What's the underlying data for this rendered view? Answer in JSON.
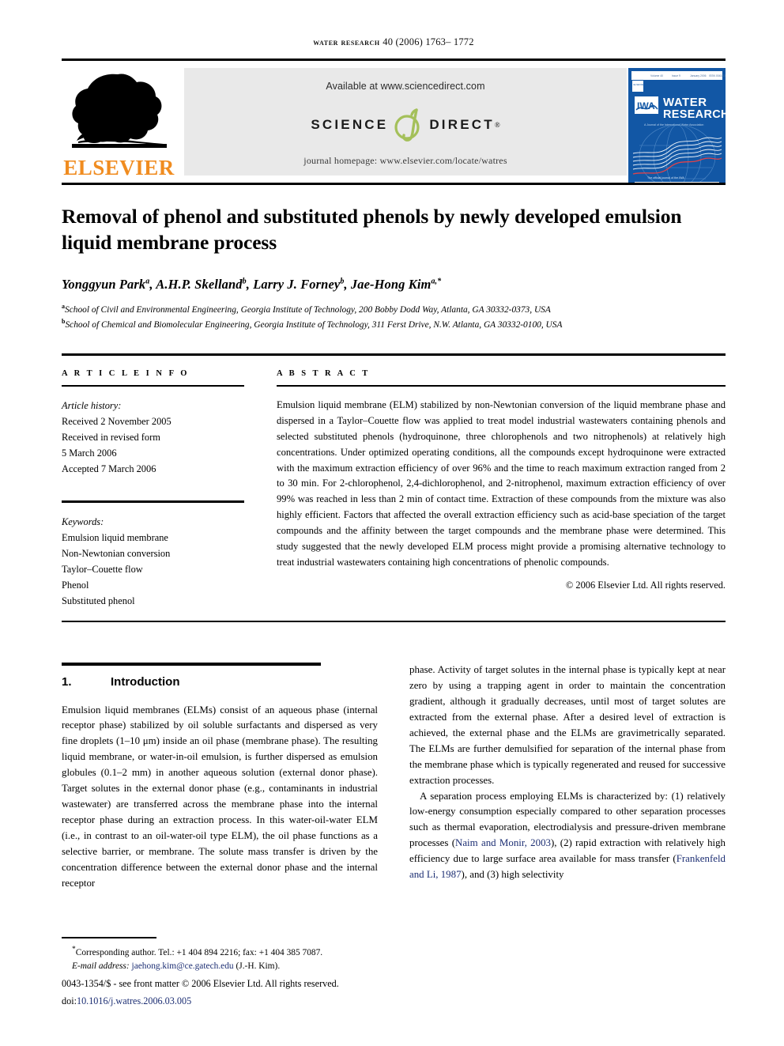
{
  "running_head": {
    "journal": "water research",
    "volume_line": "40 (2006) 1763– 1772"
  },
  "masthead": {
    "elsevier_wordmark": "ELSEVIER",
    "elsevier_color": "#F08C20",
    "sciencedirect": {
      "available_text": "Available at www.sciencedirect.com",
      "science_word": "SCIENCE",
      "direct_word": "DIRECT",
      "registered_mark": "®",
      "d_logo_color": "#A4C05A",
      "banner_bg": "#E9E9E9"
    },
    "journal_homepage": "journal homepage: www.elsevier.com/locate/watres",
    "cover": {
      "society": "IWA",
      "title_line1": "WATER",
      "title_line2": "RESEARCH",
      "tagline": "A Journal of the International Water Association",
      "bottom_tagline": "The official journal of the IWA",
      "top_bar": "Volume 40   Issue 9   January 2006   ISSN 0043-1354",
      "bg_color": "#1257A5"
    }
  },
  "article": {
    "title": "Removal of phenol and substituted phenols by newly developed emulsion liquid membrane process",
    "authors": [
      {
        "name": "Yonggyun Park",
        "sup": "a"
      },
      {
        "name": "A.H.P. Skelland",
        "sup": "b"
      },
      {
        "name": "Larry J. Forney",
        "sup": "b"
      },
      {
        "name": "Jae-Hong Kim",
        "sup": "a,*"
      }
    ],
    "affiliations": [
      {
        "sup": "a",
        "text": "School of Civil and Environmental Engineering, Georgia Institute of Technology, 200 Bobby Dodd Way, Atlanta, GA 30332-0373, USA"
      },
      {
        "sup": "b",
        "text": "School of Chemical and Biomolecular Engineering, Georgia Institute of Technology, 311 Ferst Drive, N.W. Atlanta, GA 30332-0100, USA"
      }
    ]
  },
  "article_info": {
    "heading": "A R T I C L E   I N F O",
    "history_label": "Article history:",
    "history": [
      "Received 2 November 2005",
      "Received in revised form",
      "5 March 2006",
      "Accepted 7 March 2006"
    ],
    "keywords_label": "Keywords:",
    "keywords": [
      "Emulsion liquid membrane",
      "Non-Newtonian conversion",
      "Taylor–Couette flow",
      "Phenol",
      "Substituted phenol"
    ]
  },
  "abstract": {
    "heading": "A B S T R A C T",
    "text": "Emulsion liquid membrane (ELM) stabilized by non-Newtonian conversion of the liquid membrane phase and dispersed in a Taylor–Couette flow was applied to treat model industrial wastewaters containing phenols and selected substituted phenols (hydroquinone, three chlorophenols and two nitrophenols) at relatively high concentrations. Under optimized operating conditions, all the compounds except hydroquinone were extracted with the maximum extraction efficiency of over 96% and the time to reach maximum extraction ranged from 2 to 30 min. For 2-chlorophenol, 2,4-dichlorophenol, and 2-nitrophenol, maximum extraction efficiency of over 99% was reached in less than 2 min of contact time. Extraction of these compounds from the mixture was also highly efficient. Factors that affected the overall extraction efficiency such as acid-base speciation of the target compounds and the affinity between the target compounds and the membrane phase were determined. This study suggested that the newly developed ELM process might provide a promising alternative technology to treat industrial wastewaters containing high concentrations of phenolic compounds.",
    "copyright": "© 2006 Elsevier Ltd. All rights reserved."
  },
  "body": {
    "section_number": "1.",
    "section_title": "Introduction",
    "left_paragraphs": [
      "Emulsion liquid membranes (ELMs) consist of an aqueous phase (internal receptor phase) stabilized by oil soluble surfactants and dispersed as very fine droplets (1–10 μm) inside an oil phase (membrane phase). The resulting liquid membrane, or water-in-oil emulsion, is further dispersed as emulsion globules (0.1–2 mm) in another aqueous solution (external donor phase). Target solutes in the external donor phase (e.g., contaminants in industrial wastewater) are transferred across the membrane phase into the internal receptor phase during an extraction process. In this water-oil-water ELM (i.e., in contrast to an oil-water-oil type ELM), the oil phase functions as a selective barrier, or membrane. The solute mass transfer is driven by the concentration difference between the external donor phase and the internal receptor"
    ],
    "right_paragraph_1": "phase. Activity of target solutes in the internal phase is typically kept at near zero by using a trapping agent in order to maintain the concentration gradient, although it gradually decreases, until most of target solutes are extracted from the external phase. After a desired level of extraction is achieved, the external phase and the ELMs are gravimetrically separated. The ELMs are further demulsified for separation of the internal phase from the membrane phase which is typically regenerated and reused for successive extraction processes.",
    "right_paragraph_2_part1": "A separation process employing ELMs is characterized by: (1) relatively low-energy consumption especially compared to other separation processes such as thermal evaporation, electrodialysis and pressure-driven membrane processes (",
    "right_citation_1": "Naim and Monir, 2003",
    "right_paragraph_2_part2": "), (2) rapid extraction with relatively high efficiency due to large surface area available for mass transfer (",
    "right_citation_2": "Frankenfeld and Li, 1987",
    "right_paragraph_2_part3": "), and (3) high selectivity"
  },
  "footnote": {
    "corresponding": "Corresponding author. Tel.: +1 404 894 2216; fax: +1 404 385 7087.",
    "email_label": "E-mail address:",
    "email": "jaehong.kim@ce.gatech.edu",
    "email_author": "(J.-H. Kim).",
    "issn_line": "0043-1354/$ - see front matter © 2006 Elsevier Ltd. All rights reserved.",
    "doi_label": "doi:",
    "doi": "10.1016/j.watres.2006.03.005"
  }
}
